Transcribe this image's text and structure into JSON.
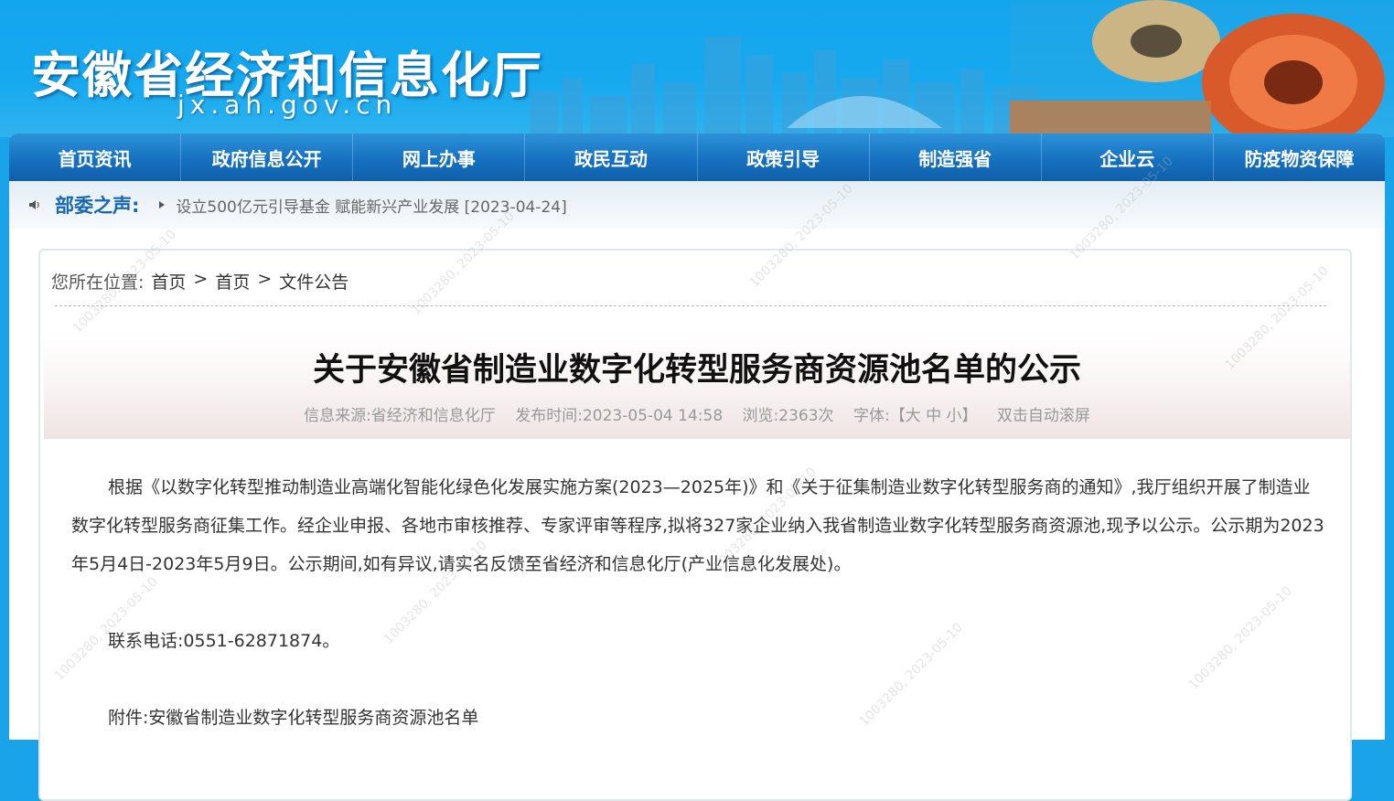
{
  "header": {
    "site_title": "安徽省经济和信息化厅",
    "site_domain": "jx.ah.gov.cn"
  },
  "nav": {
    "items": [
      "首页资讯",
      "政府信息公开",
      "网上办事",
      "政民互动",
      "政策引导",
      "制造强省",
      "企业云",
      "防疫物资保障"
    ]
  },
  "ticker": {
    "label": "部委之声:",
    "text": "设立500亿元引导基金 赋能新兴产业发展 [2023-04-24]"
  },
  "breadcrumb": {
    "prefix": "您所在位置:",
    "items": [
      "首页",
      "首页",
      "文件公告"
    ],
    "separator": ">"
  },
  "article": {
    "title": "关于安徽省制造业数字化转型服务商资源池名单的公示",
    "meta": {
      "source": "信息来源:省经济和信息化厅",
      "published": "发布时间:2023-05-04 14:58",
      "views": "浏览:2363次",
      "font_label": "字体:",
      "font_options": "【大 中 小】",
      "auto_scroll": "双击自动滚屏"
    },
    "paragraphs": [
      "根据《以数字化转型推动制造业高端化智能化绿色化发展实施方案(2023—2025年)》和《关于征集制造业数字化转型服务商的通知》,我厅组织开展了制造业数字化转型服务商征集工作。经企业申报、各地市审核推荐、专家评审等程序,拟将327家企业纳入我省制造业数字化转型服务商资源池,现予以公示。公示期为2023年5月4日-2023年5月9日。公示期间,如有异议,请实名反馈至省经济和信息化厅(产业信息化发展处)。",
      "联系电话:0551-62871874。",
      "附件:安徽省制造业数字化转型服务商资源池名单"
    ]
  },
  "watermark": "1003280, 2023-05-10",
  "colors": {
    "banner_blue": "#17a9ef",
    "nav_blue": "#1671c0",
    "ticker_label": "#1768b3"
  }
}
